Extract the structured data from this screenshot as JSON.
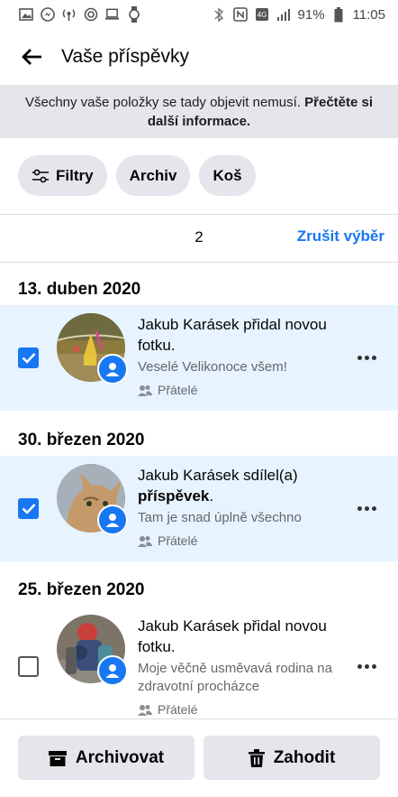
{
  "status_bar": {
    "battery": "91%",
    "time": "11:05",
    "left_icons": [
      "image-icon",
      "messenger-icon",
      "hotspot-icon",
      "nfc-ring-icon",
      "laptop-icon",
      "watch-icon"
    ],
    "right_icons": [
      "bluetooth-icon",
      "nfc-icon",
      "4g-icon",
      "signal-icon",
      "battery-icon"
    ]
  },
  "header": {
    "title": "Vaše příspěvky"
  },
  "banner": {
    "text": "Všechny vaše položky se tady objevit nemusí.",
    "link": "Přečtěte si další informace."
  },
  "chips": [
    {
      "label": "Filtry",
      "icon": "filter-sliders-icon"
    },
    {
      "label": "Archiv"
    },
    {
      "label": "Koš"
    }
  ],
  "selection": {
    "count": "2",
    "cancel": "Zrušit výběr"
  },
  "groups": [
    {
      "date": "13. duben 2020",
      "post": {
        "selected": true,
        "title": "Jakub Karásek přidal novou fotku.",
        "subtitle": "Veselé Velikonoce všem!",
        "audience": "Přátelé"
      }
    },
    {
      "date": "30. březen 2020",
      "post": {
        "selected": true,
        "title_prefix": "Jakub Karásek sdílel(a)",
        "title_bold": "příspěvek",
        "title_suffix": ".",
        "subtitle": "Tam je snad úplně všechno",
        "audience": "Přátelé"
      }
    },
    {
      "date": "25. březen 2020",
      "post": {
        "selected": false,
        "title": "Jakub Karásek přidal novou fotku.",
        "subtitle": "Moje věčně usměvavá rodina na zdravotní procházce",
        "audience": "Přátelé"
      }
    }
  ],
  "bottom": {
    "archive": "Archivovat",
    "discard": "Zahodit"
  },
  "colors": {
    "accent": "#1877f2",
    "selected_row": "#e7f3ff",
    "chip_bg": "#e4e6eb"
  }
}
